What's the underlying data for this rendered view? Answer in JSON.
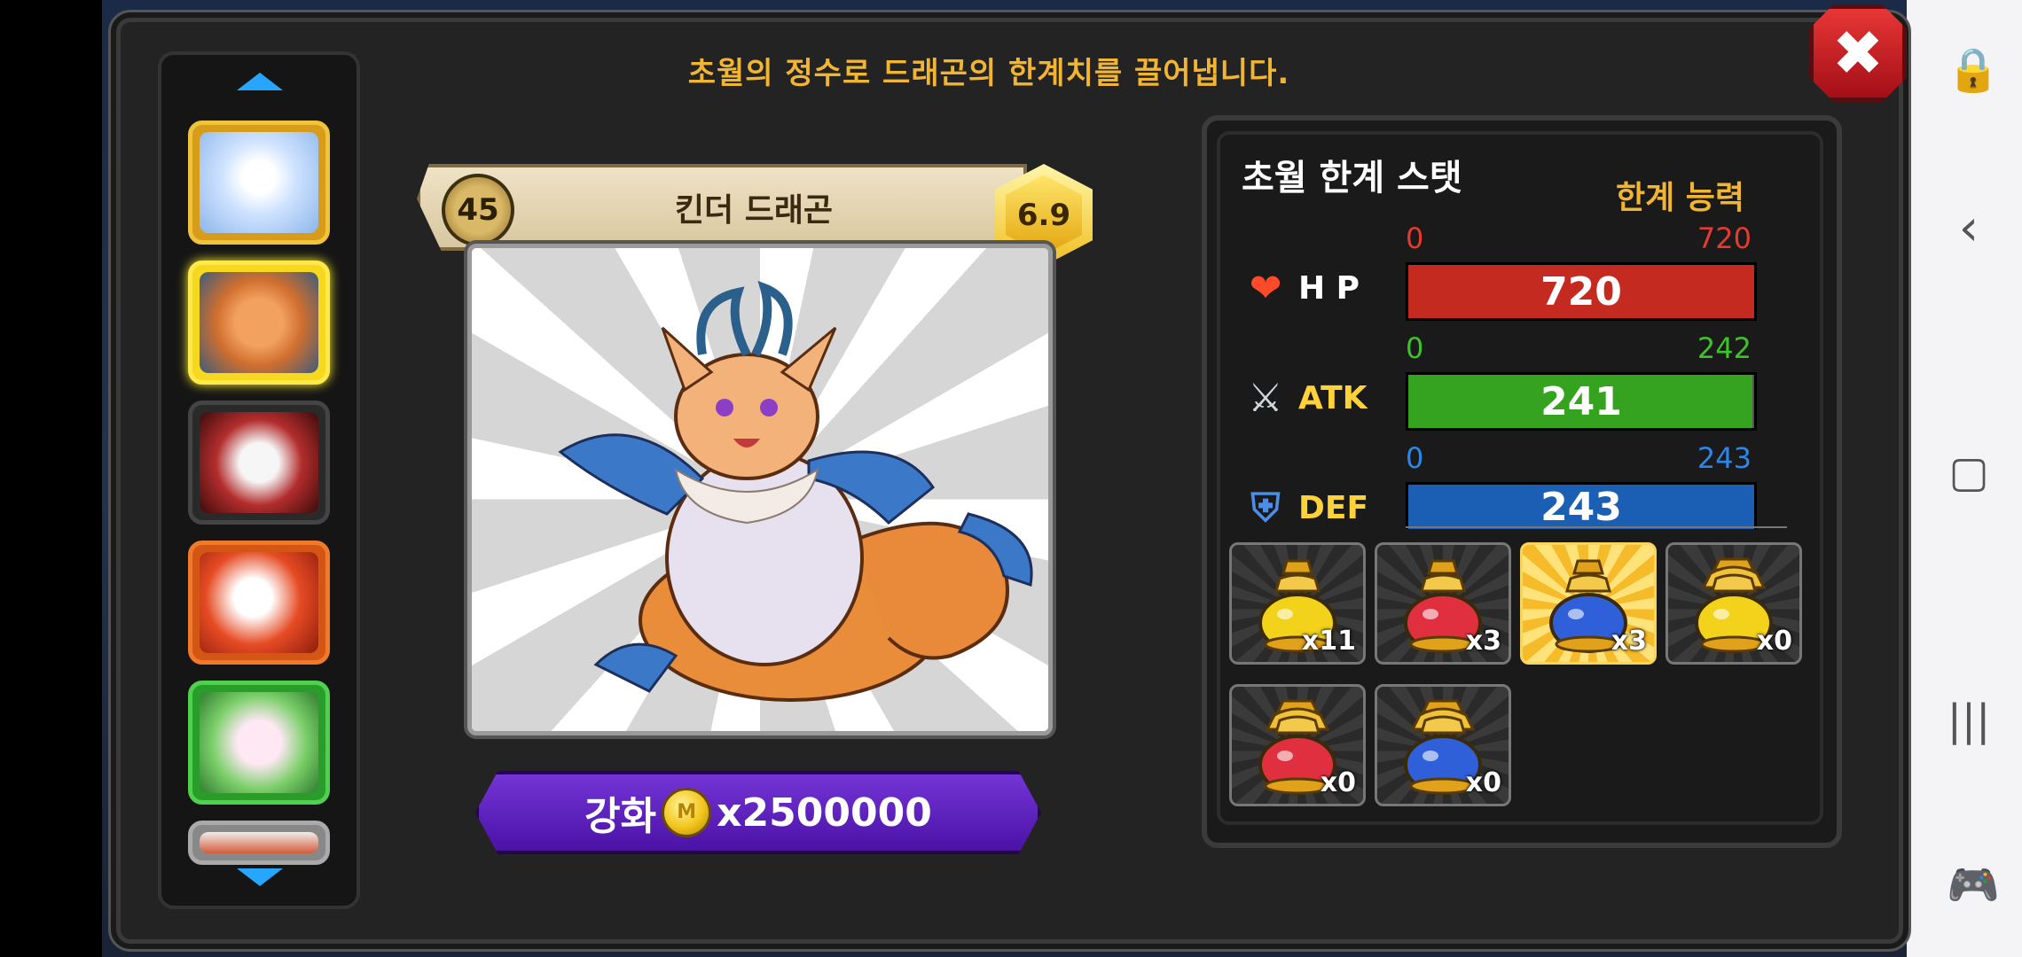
{
  "header": {
    "text": "초월의 정수로 드래곤의 한계치를 끌어냅니다."
  },
  "close_button": {
    "icon": "close-icon",
    "glyph": "✖"
  },
  "dragon_list": {
    "up_icon": "chevron-up-icon",
    "down_icon": "chevron-down-icon",
    "items": [
      {
        "name": "white-dragon",
        "selected": false
      },
      {
        "name": "kinder-dragon",
        "selected": true
      },
      {
        "name": "red-white-dragon",
        "selected": false
      },
      {
        "name": "flame-dragon",
        "selected": false
      },
      {
        "name": "pink-dragon",
        "selected": false
      },
      {
        "name": "partial-dragon",
        "selected": false
      }
    ]
  },
  "dragon": {
    "level": "45",
    "name": "킨더 드래곤",
    "grade": "6.9"
  },
  "enhance": {
    "label": "강화",
    "coin_mark": "M",
    "cost": "x2500000"
  },
  "stats": {
    "title": "초월 한계 스탯",
    "cap_label": "한계 능력",
    "hp": {
      "label": "H P",
      "min": "0",
      "max": "720",
      "value": "720",
      "fill": 1.0,
      "color": "#c42a20",
      "min_color": "#e23b2f",
      "max_color": "#e23b2f"
    },
    "atk": {
      "label": "ATK",
      "min": "0",
      "max": "242",
      "value": "241",
      "fill": 0.996,
      "color": "#35a320",
      "min_color": "#3fc12b",
      "max_color": "#3fc12b"
    },
    "def": {
      "label": "DEF",
      "min": "0",
      "max": "243",
      "value": "243",
      "fill": 1.0,
      "color": "#1b5fb4",
      "min_color": "#2c86e8",
      "max_color": "#2c86e8"
    }
  },
  "potions": [
    {
      "name": "gold-potion",
      "count": "x11",
      "color": "#f3d21c",
      "selected": false
    },
    {
      "name": "red-potion",
      "count": "x3",
      "color": "#e03040",
      "selected": false
    },
    {
      "name": "blue-potion",
      "count": "x3",
      "color": "#2f5fd9",
      "selected": true
    },
    {
      "name": "gold-large-potion",
      "count": "x0",
      "color": "#f3d21c",
      "selected": false
    },
    {
      "name": "red-large-potion",
      "count": "x0",
      "color": "#e03040",
      "selected": false
    },
    {
      "name": "blue-large-potion",
      "count": "x0",
      "color": "#2f5fd9",
      "selected": false
    }
  ],
  "system_bar": {
    "icons": [
      "touch-lock-icon",
      "back-icon",
      "home-icon",
      "recents-icon",
      "game-tools-icon"
    ]
  }
}
